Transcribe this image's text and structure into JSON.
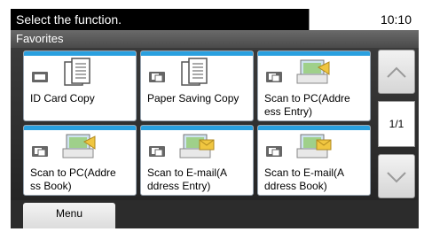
{
  "header": {
    "prompt": "Select the function.",
    "time": "10:10"
  },
  "subheader": {
    "title": "Favorites"
  },
  "tiles": [
    {
      "label": "ID Card Copy",
      "mode": "copy",
      "picture": "document-copy-icon"
    },
    {
      "label": "Paper Saving Copy",
      "mode": "copy-duplex",
      "picture": "document-copy-icon"
    },
    {
      "label": "Scan to PC(Address Entry)",
      "mode": "scan",
      "picture": "scan-to-pc-icon"
    },
    {
      "label": "Scan to PC(Address Book)",
      "mode": "scan",
      "picture": "scan-to-pc-icon"
    },
    {
      "label": "Scan to E-mail(Address Entry)",
      "mode": "scan",
      "picture": "scan-to-email-icon"
    },
    {
      "label": "Scan to E-mail(Address Book)",
      "mode": "scan",
      "picture": "scan-to-email-icon"
    }
  ],
  "tile_labels_wrapped": [
    "ID Card Copy",
    "Paper Saving Copy",
    "Scan to PC(Addre\ness Entry)",
    "Scan to PC(Addre\nss Book)",
    "Scan to E-mail(A\nddress Entry)",
    "Scan to E-mail(A\nddress Book)"
  ],
  "pagination": {
    "page": "1/1"
  },
  "footer": {
    "menu_label": "Menu"
  },
  "colors": {
    "accent": "#2aa0df"
  }
}
